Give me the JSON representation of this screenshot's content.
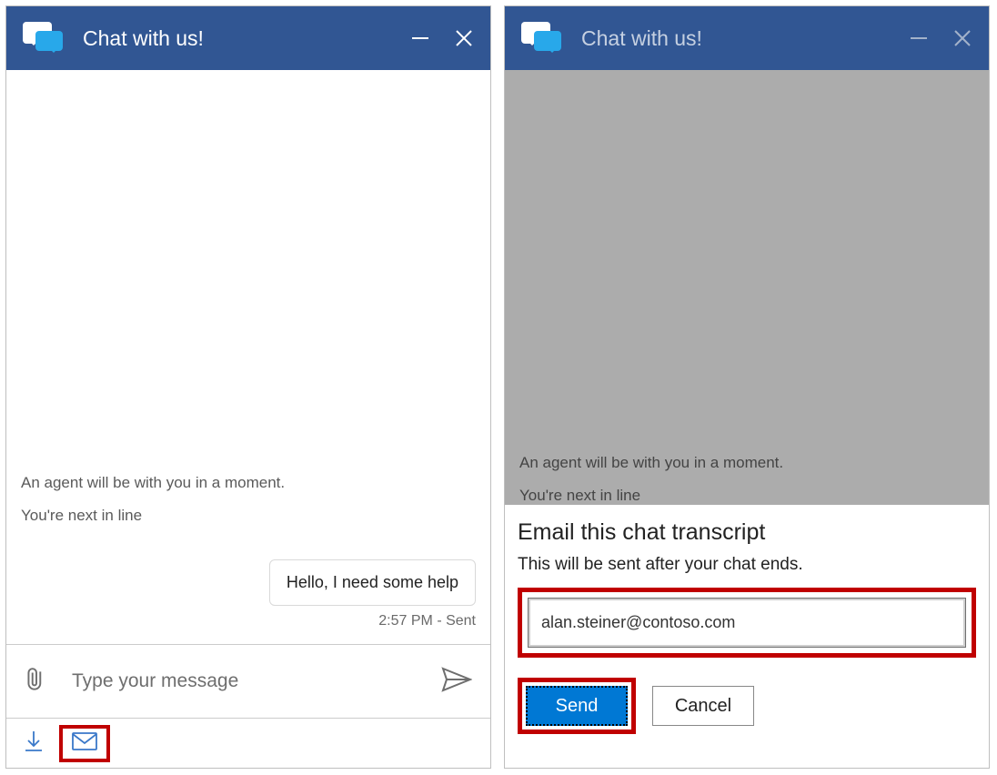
{
  "header": {
    "title": "Chat with us!"
  },
  "chat": {
    "status1": "An agent will be with you in a moment.",
    "status2": "You're next in line",
    "message": "Hello, I need some help",
    "meta": "2:57 PM - Sent",
    "input_placeholder": "Type your message"
  },
  "email_panel": {
    "title": "Email this chat transcript",
    "subtitle": "This will be sent after your chat ends.",
    "email_value": "alan.steiner@contoso.com",
    "send_label": "Send",
    "cancel_label": "Cancel"
  }
}
